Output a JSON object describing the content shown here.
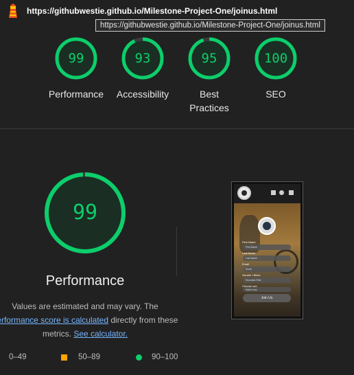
{
  "header": {
    "url": "https://githubwestie.github.io/Milestone-Project-One/joinus.html",
    "tooltip": "https://githubwestie.github.io/Milestone-Project-One/joinus.html",
    "logo_icon": "lighthouse-icon"
  },
  "summary": [
    {
      "score": "99",
      "label": "Performance"
    },
    {
      "score": "93",
      "label": "Accessibility"
    },
    {
      "score": "95",
      "label_line1": "Best",
      "label_line2": "Practices"
    },
    {
      "score": "100",
      "label": "SEO"
    }
  ],
  "detail": {
    "score": "99",
    "score_fraction": 0.99,
    "title": "Performance",
    "desc_line1": "Values are estimated and may vary. The",
    "desc_link1": "performance score is calculated",
    "desc_mid": " directly from these",
    "desc_line3a": "metrics. ",
    "desc_link2": "See calculator."
  },
  "legend": {
    "range_red": "0–49",
    "range_orange": "50–89",
    "range_green": "90–100"
  },
  "thumbnail": {
    "labels": [
      "First Name",
      "Last Name",
      "Email",
      "Gender / Bikes",
      "Choose one"
    ],
    "fields": [
      "First Name",
      "Last Name",
      "Email",
      "Mountain Ride",
      "Select one"
    ],
    "button": "Join Us"
  },
  "colors": {
    "pass": "#0cce6b",
    "average": "#ffa400",
    "fail": "#ff4e42",
    "background": "#212121",
    "link": "#78b7ff"
  }
}
